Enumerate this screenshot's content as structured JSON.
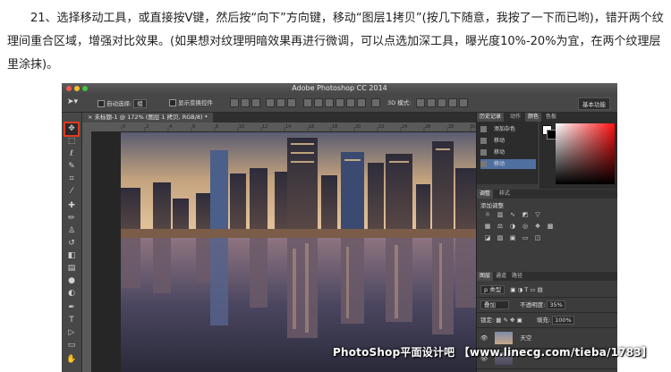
{
  "article": {
    "paragraph": "21、选择移动工具，或直接按V键，然后按“向下”方向键，移动“图层1拷贝”(按几下随意，我按了一下而已哟)，错开两个纹理间重合区域，增强对比效果。(如果想对纹理明暗效果再进行微调，可以点选加深工具，曝光度10%-20%为宜，在两个纹理层里涂抹)。"
  },
  "window": {
    "title": "Adobe Photoshop CC 2014",
    "traffic_lights": [
      "#f25a52",
      "#f6bd2f",
      "#3fc43f"
    ]
  },
  "options_bar": {
    "move_icon": "move-tool-icon",
    "auto_select_label": "自动选择:",
    "auto_select_value": "组",
    "show_transform_label": "显示变换控件",
    "mode_3d_label": "3D 模式:",
    "workspace_label": "基本功能"
  },
  "document_tab": {
    "label": "未标题-1 @ 172% (图层 1 拷贝, RGB/8) *"
  },
  "ruler_numbers": [
    "0",
    "2",
    "4",
    "6",
    "8",
    "10",
    "12",
    "14",
    "16",
    "18",
    "20",
    "22",
    "24",
    "26",
    "28",
    "30"
  ],
  "tools": [
    {
      "name": "move-tool",
      "glyph": "✥",
      "active": true
    },
    {
      "name": "marquee-tool",
      "glyph": "⬚"
    },
    {
      "name": "lasso-tool",
      "glyph": "ℓ"
    },
    {
      "name": "quick-select-tool",
      "glyph": "✎"
    },
    {
      "name": "crop-tool",
      "glyph": "⌗"
    },
    {
      "name": "eyedropper-tool",
      "glyph": "⁄"
    },
    {
      "name": "healing-brush-tool",
      "glyph": "✚"
    },
    {
      "name": "brush-tool",
      "glyph": "✏"
    },
    {
      "name": "clone-stamp-tool",
      "glyph": "♙"
    },
    {
      "name": "history-brush-tool",
      "glyph": "↺"
    },
    {
      "name": "eraser-tool",
      "glyph": "◧"
    },
    {
      "name": "gradient-tool",
      "glyph": "▤"
    },
    {
      "name": "blur-tool",
      "glyph": "●"
    },
    {
      "name": "dodge-tool",
      "glyph": "◐"
    },
    {
      "name": "pen-tool",
      "glyph": "✒"
    },
    {
      "name": "type-tool",
      "glyph": "T"
    },
    {
      "name": "path-select-tool",
      "glyph": "▷"
    },
    {
      "name": "shape-tool",
      "glyph": "▭"
    }
  ],
  "panels": {
    "top_tabs": [
      "历史记录",
      "动作",
      "颜色",
      "色板"
    ],
    "history_items": [
      "添加杂色",
      "移动",
      "移动",
      "移动"
    ],
    "adjust_tabs": [
      "调整",
      "样式"
    ],
    "adjust_title": "添加调整",
    "layer_tabs": [
      "图层",
      "通道",
      "路径"
    ],
    "kind_label": "p 类型",
    "blend_mode": "叠加",
    "opacity_label": "不透明度:",
    "opacity_value": "35%",
    "lock_label": "锁定:",
    "fill_label": "填充:",
    "fill_value": "100%",
    "layer_name": "天空"
  },
  "colors": {
    "accent_red": "#e03a1f",
    "panel_bg": "#3c3c3c",
    "selection_blue": "#4f6fa0"
  },
  "watermark": "PhotoShop平面设计吧 【www.linecg.com/tieba/1783】"
}
